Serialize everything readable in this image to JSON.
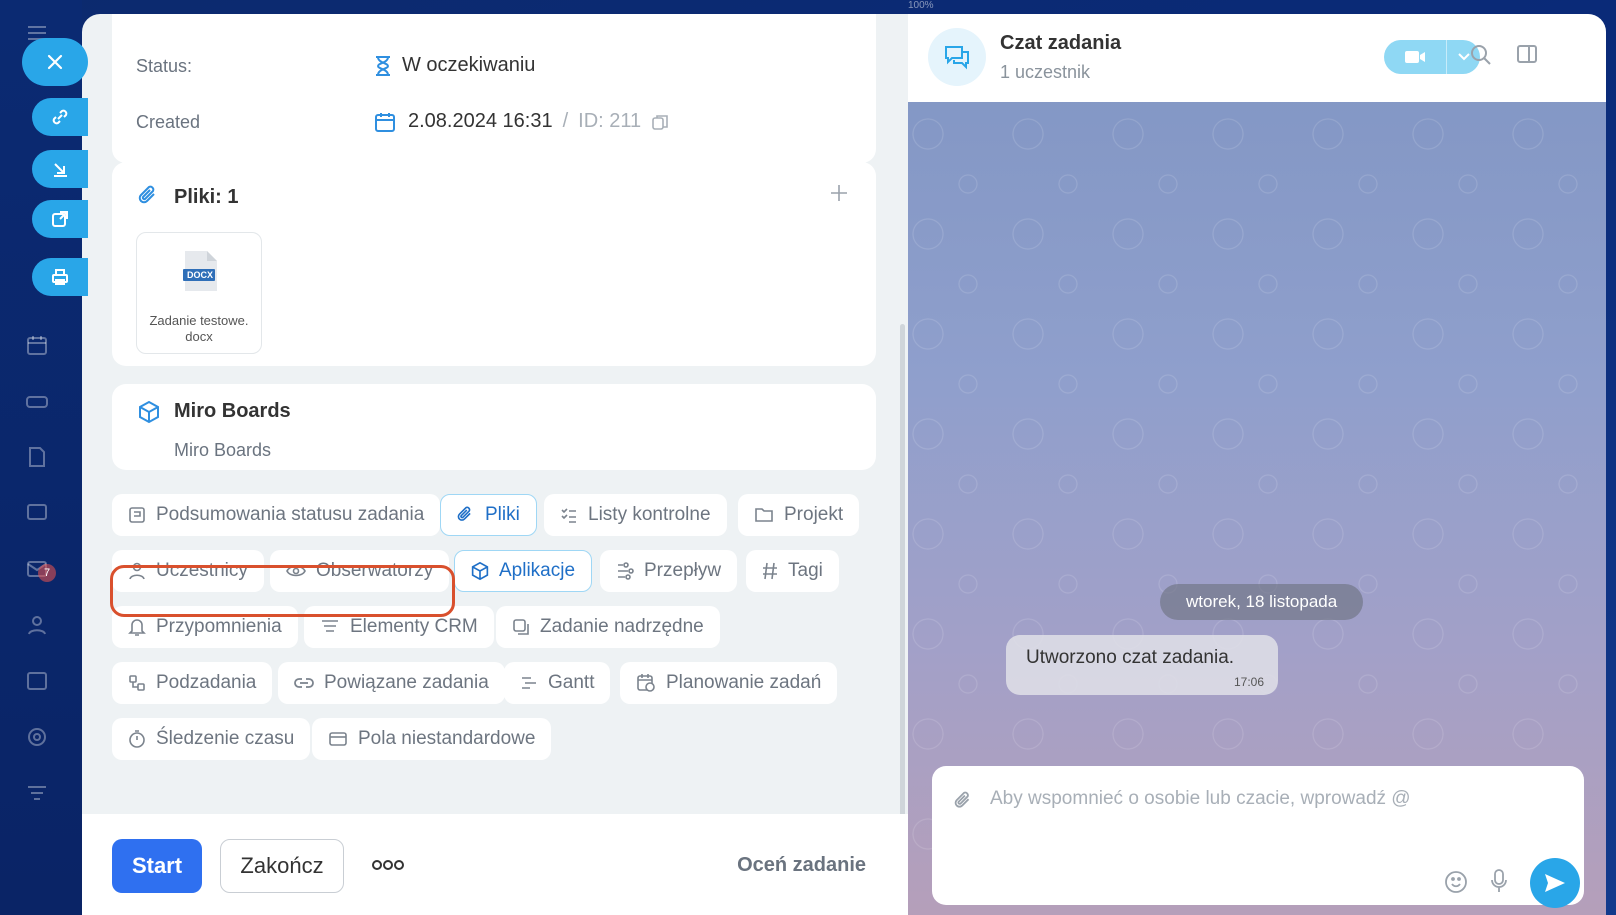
{
  "task": {
    "status_label": "Status:",
    "status_value": "W oczekiwaniu",
    "created_label": "Created",
    "created_value": "2.08.2024 16:31",
    "separator": "/",
    "id_value": "ID: 211"
  },
  "files": {
    "title": "Pliki: 1",
    "items": [
      {
        "name": "Zadanie testowe.docx",
        "type_badge": "DOCX"
      }
    ]
  },
  "apps": {
    "title": "Miro Boards",
    "subtitle": "Miro Boards"
  },
  "chips": [
    {
      "label": "Podsumowania statusu zadania",
      "icon": "summary-icon"
    },
    {
      "label": "Pliki",
      "icon": "paperclip-icon",
      "active": true
    },
    {
      "label": "Listy kontrolne",
      "icon": "checklist-icon"
    },
    {
      "label": "Projekt",
      "icon": "folder-icon"
    },
    {
      "label": "Uczestnicy",
      "icon": "person-icon"
    },
    {
      "label": "Obserwatorzy",
      "icon": "eye-icon"
    },
    {
      "label": "Aplikacje",
      "icon": "cube-icon",
      "active": true
    },
    {
      "label": "Przepływ",
      "icon": "flow-icon"
    },
    {
      "label": "Tagi",
      "icon": "hash-icon"
    },
    {
      "label": "Przypomnienia",
      "icon": "bell-icon"
    },
    {
      "label": "Elementy CRM",
      "icon": "crm-icon"
    },
    {
      "label": "Zadanie nadrzędne",
      "icon": "parent-task-icon"
    },
    {
      "label": "Podzadania",
      "icon": "subtasks-icon"
    },
    {
      "label": "Powiązane zadania",
      "icon": "link-icon"
    },
    {
      "label": "Gantt",
      "icon": "gantt-icon"
    },
    {
      "label": "Planowanie zadań",
      "icon": "calendar-clock-icon"
    },
    {
      "label": "Śledzenie czasu",
      "icon": "stopwatch-icon"
    },
    {
      "label": "Pola niestandardowe",
      "icon": "custom-fields-icon"
    }
  ],
  "footer": {
    "start_label": "Start",
    "finish_label": "Zakończ",
    "more_label": "ooo",
    "rate_label": "Oceń zadanie"
  },
  "chat": {
    "title": "Czat zadania",
    "subtitle": "1 uczestnik",
    "date_divider": "wtorek, 18 listopada",
    "messages": [
      {
        "text": "Utworzono czat zadania.",
        "time": "17:06"
      }
    ],
    "composer_placeholder": "Aby wspomnieć o osobie lub czacie, wprowadź @"
  },
  "sidebar": {
    "badge_count": "7"
  },
  "zoom_indicator": "100%",
  "colors": {
    "accent": "#29a6e8",
    "primary_button": "#2f70f0",
    "highlight": "#d9502d",
    "active_chip_text": "#1f6fc7"
  }
}
